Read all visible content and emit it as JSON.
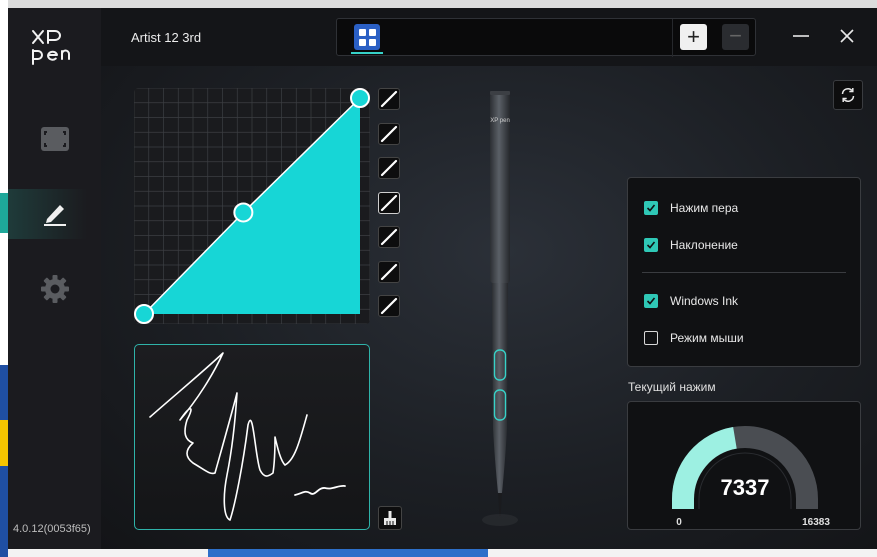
{
  "app": {
    "logo_text": "XP pen",
    "device_name": "Artist 12 3rd",
    "version": "4.0.12(0053f65)"
  },
  "colors": {
    "accent": "#2fc8b6",
    "curve_fill": "#17d6d6",
    "app_tile": "#2a5fc4",
    "window_bg": "#121316"
  },
  "sidebar": {
    "items": [
      {
        "name": "display-mapping",
        "icon": "screen-frame-icon",
        "active": false
      },
      {
        "name": "pen",
        "icon": "pen-icon",
        "active": true
      },
      {
        "name": "settings",
        "icon": "gear-icon",
        "active": false
      }
    ]
  },
  "tabs": {
    "app_icon": "windows-apps-icon",
    "add_label": "+",
    "remove_label": "−"
  },
  "pressure_curve": {
    "points": [
      [
        0,
        0
      ],
      [
        0.46,
        0.47
      ],
      [
        1,
        1
      ]
    ],
    "presets_count": 7,
    "selected_preset": 3
  },
  "options": {
    "items": [
      {
        "label": "Нажим пера",
        "checked": true
      },
      {
        "label": "Наклонение",
        "checked": true
      },
      {
        "label": "Windows Ink",
        "checked": true
      },
      {
        "label": "Режим мыши",
        "checked": false
      }
    ]
  },
  "pressure": {
    "label": "Текущий нажим",
    "value": "7337",
    "min": "0",
    "max": "16383",
    "level": 0.448
  },
  "pen_brand": "XP pen"
}
